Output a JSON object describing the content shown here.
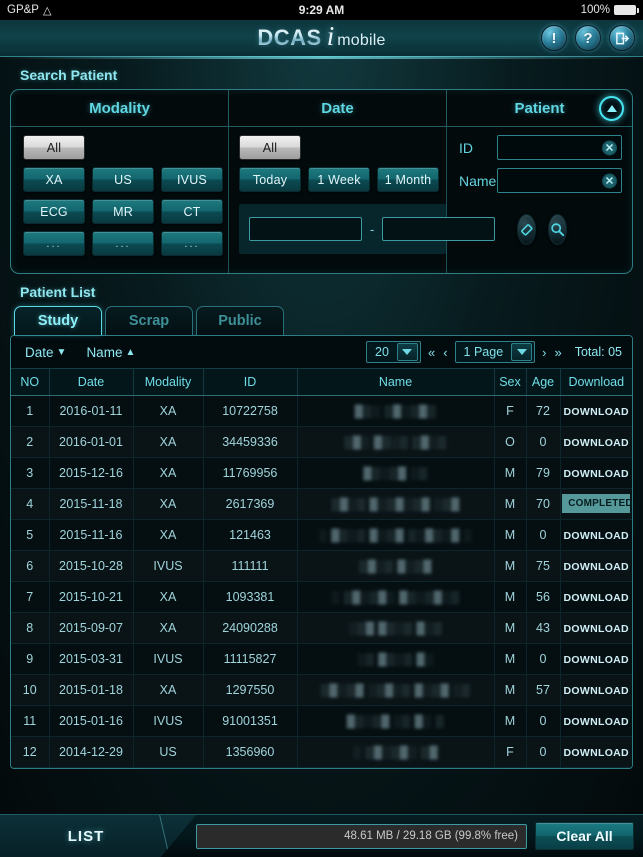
{
  "statusbar": {
    "carrier": "GP&P",
    "wifi_icon": "wifi-icon",
    "time": "9:29 AM",
    "battery_pct": "100%"
  },
  "header": {
    "logo_main": "DCAS",
    "logo_i": "i",
    "logo_sub": "mobile",
    "icons": [
      {
        "name": "info-icon",
        "glyph": "!"
      },
      {
        "name": "help-icon",
        "glyph": "?"
      },
      {
        "name": "logout-icon",
        "glyph": ""
      }
    ]
  },
  "search": {
    "title": "Search Patient",
    "columns": {
      "modality": "Modality",
      "date": "Date",
      "patient": "Patient"
    },
    "collapse_icon": "chevron-up-icon",
    "modality_buttons": [
      {
        "label": "All",
        "selected": true
      },
      {
        "label": "XA",
        "selected": false
      },
      {
        "label": "US",
        "selected": false
      },
      {
        "label": "IVUS",
        "selected": false
      },
      {
        "label": "ECG",
        "selected": false
      },
      {
        "label": "MR",
        "selected": false
      },
      {
        "label": "CT",
        "selected": false
      },
      {
        "label": "...",
        "selected": false
      },
      {
        "label": "...",
        "selected": false
      },
      {
        "label": "...",
        "selected": false
      }
    ],
    "date_buttons": [
      {
        "label": "All",
        "selected": true
      },
      {
        "label": "Today",
        "selected": false
      },
      {
        "label": "1 Week",
        "selected": false
      },
      {
        "label": "1 Month",
        "selected": false
      }
    ],
    "patient_fields": [
      {
        "label": "ID",
        "value": "",
        "clear_icon": "clear-circle-icon"
      },
      {
        "label": "Name",
        "value": "",
        "clear_icon": "clear-circle-icon"
      }
    ],
    "range": {
      "from_value": "",
      "to_value": "",
      "separator": "-",
      "reset_icon": "eraser-icon",
      "search_icon": "magnifier-icon"
    }
  },
  "patient_list": {
    "title": "Patient List",
    "tabs": [
      {
        "label": "Study",
        "active": true
      },
      {
        "label": "Scrap",
        "active": false
      },
      {
        "label": "Public",
        "active": false
      }
    ],
    "toolbar": {
      "sort_date": "Date",
      "sort_date_arrow": "▼",
      "sort_name": "Name",
      "sort_name_arrow": "▲",
      "page_size": "20",
      "first_page_icon": "«",
      "prev_page_icon": "‹",
      "page_value": "1 Page",
      "next_page_icon": "›",
      "last_page_icon": "»",
      "total": "Total: 05"
    },
    "columns": [
      "NO",
      "Date",
      "Modality",
      "ID",
      "Name",
      "Sex",
      "Age",
      "Download"
    ],
    "rows": [
      {
        "no": "1",
        "date": "2016-01-11",
        "modality": "XA",
        "id": "10722758",
        "name": "█▒░ ▒█░▒█▒",
        "sex": "F",
        "age": "72",
        "action": "DOWNLOAD",
        "completed": false
      },
      {
        "no": "2",
        "date": "2016-01-01",
        "modality": "XA",
        "id": "34459336",
        "name": "▒█░ █▒░▒ ▒█░▒",
        "sex": "O",
        "age": "0",
        "action": "DOWNLOAD",
        "completed": false
      },
      {
        "no": "3",
        "date": "2015-12-16",
        "modality": "XA",
        "id": "11769956",
        "name": "█▒░▒█ ░▒",
        "sex": "M",
        "age": "79",
        "action": "DOWNLOAD",
        "completed": false
      },
      {
        "no": "4",
        "date": "2015-11-18",
        "modality": "XA",
        "id": "2617369",
        "name": "▒█░▒ █░▒█░▒█ ░▒█",
        "sex": "M",
        "age": "70",
        "action": "COMPLETED",
        "completed": true
      },
      {
        "no": "5",
        "date": "2015-11-16",
        "modality": "XA",
        "id": "121463",
        "name": "░ █▒░▒ █░▒█ ▒░█▒░█ ░",
        "sex": "M",
        "age": "0",
        "action": "DOWNLOAD",
        "completed": false
      },
      {
        "no": "6",
        "date": "2015-10-28",
        "modality": "IVUS",
        "id": "111111",
        "name": "▒█░▒ █░▒█",
        "sex": "M",
        "age": "75",
        "action": "DOWNLOAD",
        "completed": false
      },
      {
        "no": "7",
        "date": "2015-10-21",
        "modality": "XA",
        "id": "1093381",
        "name": "░ ▒█░▒█░ █▒░▒█░▒",
        "sex": "M",
        "age": "56",
        "action": "DOWNLOAD",
        "completed": false
      },
      {
        "no": "8",
        "date": "2015-09-07",
        "modality": "XA",
        "id": "24090288",
        "name": "░▒█ █▒░▒ █░▒",
        "sex": "M",
        "age": "43",
        "action": "DOWNLOAD",
        "completed": false
      },
      {
        "no": "9",
        "date": "2015-03-31",
        "modality": "IVUS",
        "id": "11115827",
        "name": "░▒ █▒░▒ █░",
        "sex": "M",
        "age": "0",
        "action": "DOWNLOAD",
        "completed": false
      },
      {
        "no": "10",
        "date": "2015-01-18",
        "modality": "XA",
        "id": "1297550",
        "name": "▒█░▒█ ░▒█░▒ █░▒█ ░▒",
        "sex": "M",
        "age": "57",
        "action": "DOWNLOAD",
        "completed": false
      },
      {
        "no": "11",
        "date": "2015-01-16",
        "modality": "IVUS",
        "id": "91001351",
        "name": "█▒░▒█ ░▒ █░ ▒",
        "sex": "M",
        "age": "0",
        "action": "DOWNLOAD",
        "completed": false
      },
      {
        "no": "12",
        "date": "2014-12-29",
        "modality": "US",
        "id": "1356960",
        "name": "░ ▒█░▒█░ ▒█",
        "sex": "F",
        "age": "0",
        "action": "DOWNLOAD",
        "completed": false
      }
    ]
  },
  "bottom": {
    "list_label": "LIST",
    "storage_text": "48.61 MB / 29.18 GB (99.8% free)",
    "clear_all": "Clear All"
  },
  "colors": {
    "accent_cyan": "#5fd7e2",
    "bright_cyan": "#8df0fa",
    "panel_border": "#2e7c84",
    "button_teal": "#14666d",
    "completed_badge": "#55999b",
    "background_dark": "#03090b"
  }
}
